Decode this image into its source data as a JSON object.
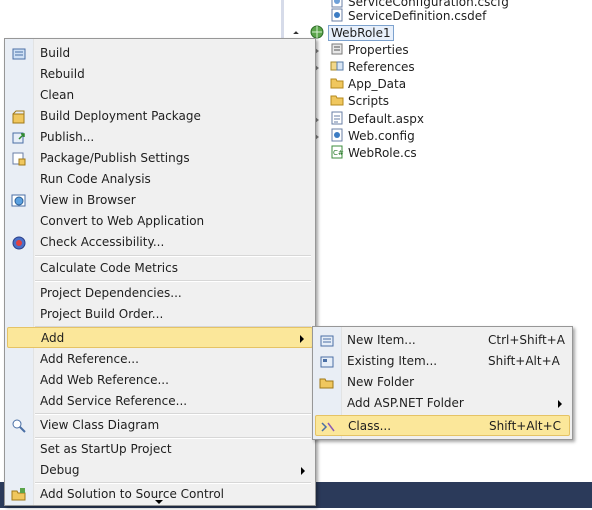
{
  "solution_explorer": {
    "items": [
      {
        "label": "ServiceConfiguration.cscfg",
        "icon": "config-file-icon"
      },
      {
        "label": "ServiceDefinition.csdef",
        "icon": "definition-file-icon"
      },
      {
        "label": "WebRole1",
        "icon": "web-project-icon",
        "selected": true,
        "expanded": true
      },
      {
        "label": "Properties",
        "icon": "properties-icon"
      },
      {
        "label": "References",
        "icon": "references-icon"
      },
      {
        "label": "App_Data",
        "icon": "folder-icon"
      },
      {
        "label": "Scripts",
        "icon": "folder-icon"
      },
      {
        "label": "Default.aspx",
        "icon": "aspx-file-icon"
      },
      {
        "label": "Web.config",
        "icon": "config-file-icon"
      },
      {
        "label": "WebRole.cs",
        "icon": "csharp-file-icon"
      }
    ]
  },
  "context_menu": {
    "items": [
      {
        "label": "Build",
        "icon": "build-icon"
      },
      {
        "label": "Rebuild"
      },
      {
        "label": "Clean"
      },
      {
        "label": "Build Deployment Package",
        "icon": "package-icon"
      },
      {
        "label": "Publish...",
        "icon": "publish-icon"
      },
      {
        "label": "Package/Publish Settings",
        "icon": "settings-icon"
      },
      {
        "label": "Run Code Analysis"
      },
      {
        "label": "View in Browser",
        "icon": "browser-icon"
      },
      {
        "label": "Convert to Web Application"
      },
      {
        "label": "Check Accessibility...",
        "icon": "accessibility-icon"
      },
      {
        "label": "Calculate Code Metrics"
      },
      {
        "label": "Project Dependencies..."
      },
      {
        "label": "Project Build Order..."
      },
      {
        "label": "Add",
        "submenu": true,
        "highlighted": true
      },
      {
        "label": "Add Reference..."
      },
      {
        "label": "Add Web Reference..."
      },
      {
        "label": "Add Service Reference..."
      },
      {
        "label": "View Class Diagram",
        "icon": "class-diagram-icon"
      },
      {
        "label": "Set as StartUp Project"
      },
      {
        "label": "Debug",
        "submenu": true
      },
      {
        "label": "Add Solution to Source Control",
        "icon": "source-control-icon"
      }
    ]
  },
  "add_submenu": {
    "items": [
      {
        "label": "New Item...",
        "shortcut": "Ctrl+Shift+A",
        "icon": "new-item-icon"
      },
      {
        "label": "Existing Item...",
        "shortcut": "Shift+Alt+A",
        "icon": "existing-item-icon"
      },
      {
        "label": "New Folder",
        "shortcut": "",
        "icon": "new-folder-icon"
      },
      {
        "label": "Add ASP.NET Folder",
        "shortcut": "",
        "submenu": true
      },
      {
        "label": "Class...",
        "shortcut": "Shift+Alt+C",
        "icon": "class-icon",
        "highlighted": true
      }
    ]
  },
  "colors": {
    "highlight": "#fbe79a",
    "highlight_border": "#e5c365",
    "menu_bg": "#f0f0f0",
    "gutter": "#e9eef5",
    "statusbar": "#2b3a5a"
  }
}
